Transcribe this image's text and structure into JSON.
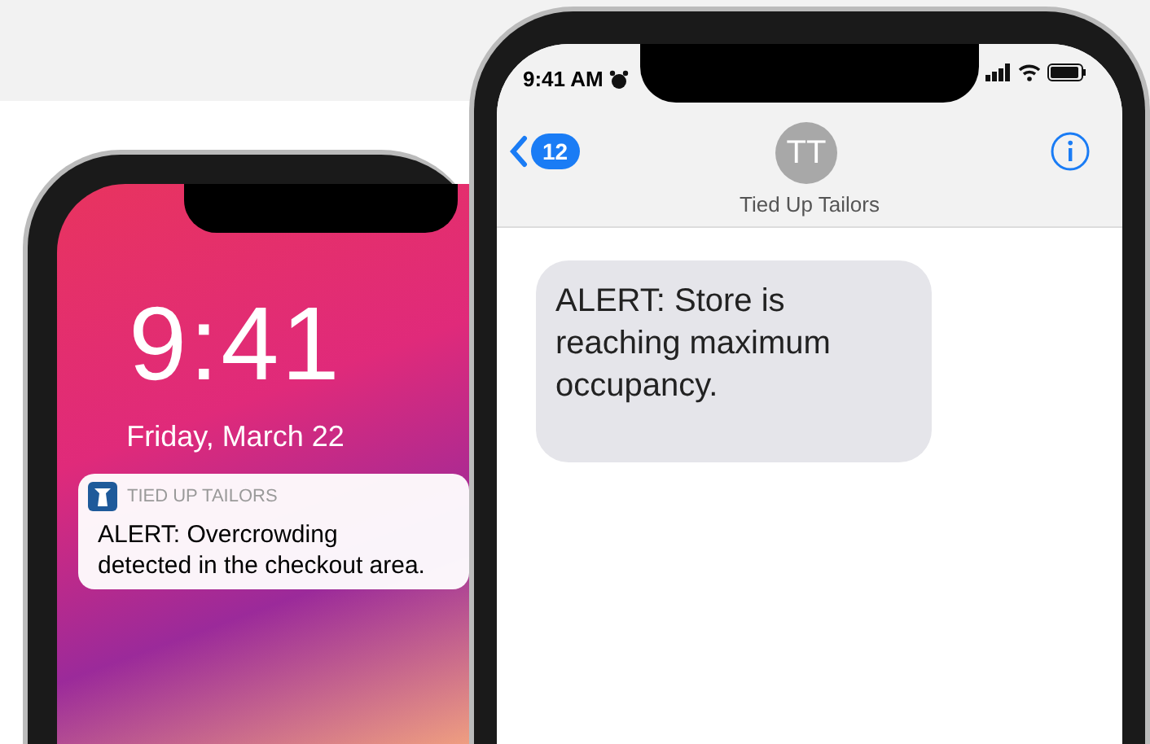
{
  "lock_screen_phone": {
    "time": "9:41",
    "date": "Friday, March 22",
    "notification": {
      "app_name": "TIED UP TAILORS",
      "message": "ALERT: Overcrowding detected in the checkout area."
    }
  },
  "messages_phone": {
    "status_bar": {
      "time": "9:41 AM"
    },
    "header": {
      "unread_count": "12",
      "avatar_initials": "TT",
      "contact_name": "Tied Up Tailors"
    },
    "messages": [
      {
        "kind": "received",
        "text": "ALERT: Store is reaching maximum occupancy."
      }
    ]
  }
}
